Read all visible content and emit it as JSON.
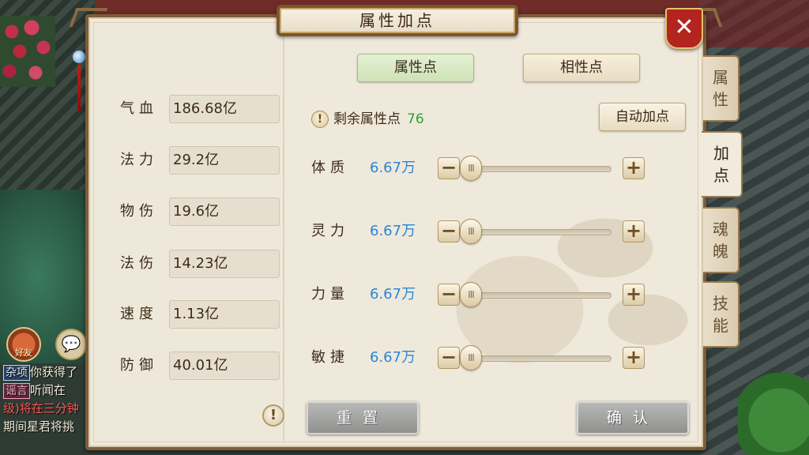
{
  "window": {
    "title": "属性加点",
    "close_glyph": "✕"
  },
  "stats": [
    {
      "label": "气血",
      "value": "186.68亿"
    },
    {
      "label": "法力",
      "value": "29.2亿"
    },
    {
      "label": "物伤",
      "value": "19.6亿"
    },
    {
      "label": "法伤",
      "value": "14.23亿"
    },
    {
      "label": "速度",
      "value": "1.13亿"
    },
    {
      "label": "防御",
      "value": "40.01亿"
    }
  ],
  "info_glyph": "!",
  "tabs": {
    "attribute": "属性点",
    "affinity": "相性点"
  },
  "remaining": {
    "label": "剩余属性点",
    "value": "76"
  },
  "auto_button": "自动加点",
  "attributes": [
    {
      "label": "体质",
      "value": "6.67万",
      "level": 0
    },
    {
      "label": "灵力",
      "value": "6.67万",
      "level": 0
    },
    {
      "label": "力量",
      "value": "6.67万",
      "level": 0
    },
    {
      "label": "敏捷",
      "value": "6.67万",
      "level": 0
    }
  ],
  "controls": {
    "minus": "−",
    "plus": "+",
    "handle_grip": "III"
  },
  "buttons": {
    "reset": "重置",
    "confirm": "确认"
  },
  "side_tabs": [
    {
      "label": "属\n性",
      "active": false
    },
    {
      "label": "加\n点",
      "active": true
    },
    {
      "label": "魂\n魄",
      "active": false
    },
    {
      "label": "技\n能",
      "active": false
    }
  ],
  "hud": {
    "friend_label": "好友",
    "chat_icon": "💬"
  },
  "chat": [
    {
      "tag": "杂项",
      "text": "你获得了"
    },
    {
      "tag": "谣言",
      "text": "听闻在"
    },
    {
      "tag": "",
      "text": "级)将在三分钟"
    },
    {
      "tag": "",
      "text": "期间星君将挑"
    }
  ],
  "colors": {
    "remaining_value": "#2aa532",
    "attribute_value": "#2a86d8",
    "close_button": "#b3241f",
    "active_tab": "#cfe2b8"
  }
}
